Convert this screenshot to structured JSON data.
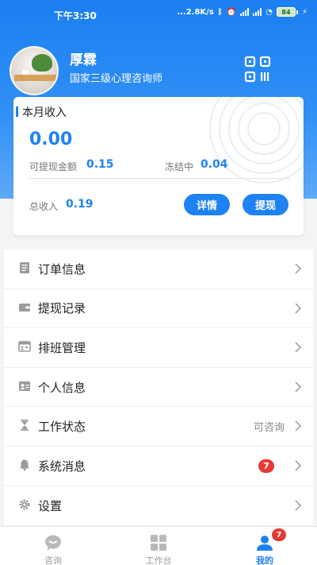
{
  "status_bar": {
    "time": "下午3:30",
    "net_speed": "...2.8K/s",
    "battery": "84"
  },
  "profile": {
    "name": "厚霖",
    "title": "国家三级心理咨询师"
  },
  "income": {
    "title": "本月收入",
    "amount": "0.00",
    "withdrawable_label": "可提现金额",
    "withdrawable_value": "0.15",
    "frozen_label": "冻结中",
    "frozen_value": "0.04",
    "total_label": "总收入",
    "total_value": "0.19",
    "details_button": "详情",
    "withdraw_button": "提现"
  },
  "menu": [
    {
      "label": "订单信息",
      "icon": "order-list-icon"
    },
    {
      "label": "提现记录",
      "icon": "wallet-icon"
    },
    {
      "label": "排班管理",
      "icon": "schedule-icon"
    },
    {
      "label": "个人信息",
      "icon": "id-card-icon"
    },
    {
      "label": "工作状态",
      "icon": "hourglass-icon",
      "value": "可咨询"
    },
    {
      "label": "系统消息",
      "icon": "bell-icon",
      "badge": "7"
    },
    {
      "label": "设置",
      "icon": "gear-icon"
    }
  ],
  "tabs": [
    {
      "label": "咨询",
      "icon": "chat-bubble-icon"
    },
    {
      "label": "工作台",
      "icon": "grid-dashboard-icon"
    },
    {
      "label": "我的",
      "icon": "user-icon",
      "badge": "7",
      "active": true
    }
  ],
  "colors": {
    "accent": "#1e82f2",
    "badge": "#e53935",
    "header_top": "#1b7ff2"
  }
}
